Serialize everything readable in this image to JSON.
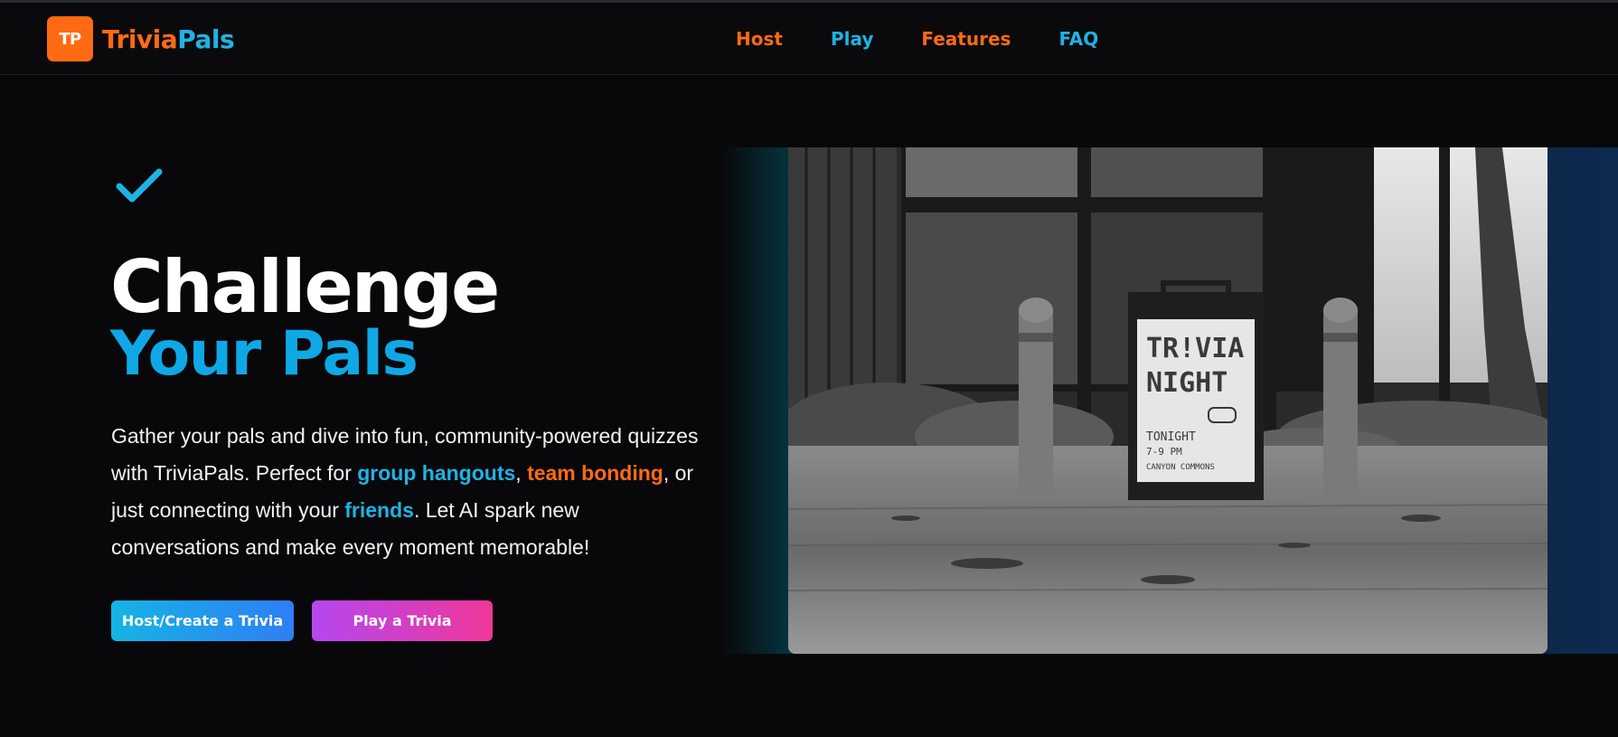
{
  "header": {
    "logo_badge": "TP",
    "logo_text_part1": "Trivia",
    "logo_text_part2": "Pals",
    "nav": [
      {
        "label": "Host"
      },
      {
        "label": "Play"
      },
      {
        "label": "Features"
      },
      {
        "label": "FAQ"
      }
    ]
  },
  "hero": {
    "icon": "check-icon",
    "title_line1": "Challenge",
    "title_line2": "Your Pals",
    "description": {
      "part1": "Gather your pals and dive into fun, community-powered quizzes with TriviaPals. Perfect for ",
      "highlight1": "group hangouts",
      "part2": ", ",
      "highlight2": "team bonding",
      "part3": ", or just connecting with your ",
      "highlight3": "friends",
      "part4": ". Let AI spark new conversations and make every moment memorable!"
    },
    "buttons": {
      "host_label": "Host/Create a Trivia",
      "play_label": "Play a Trivia"
    },
    "image": {
      "sign_line1": "TR!VIA",
      "sign_line2": "NIGHT",
      "sign_line3": "TONIGHT",
      "sign_line4": "7-9 PM",
      "sign_line5": "CANYON COMMONS"
    }
  },
  "colors": {
    "background": "#08080b",
    "orange": "#ff6a13",
    "blue": "#1fb3e3",
    "title_blue": "#0fa8e6"
  }
}
